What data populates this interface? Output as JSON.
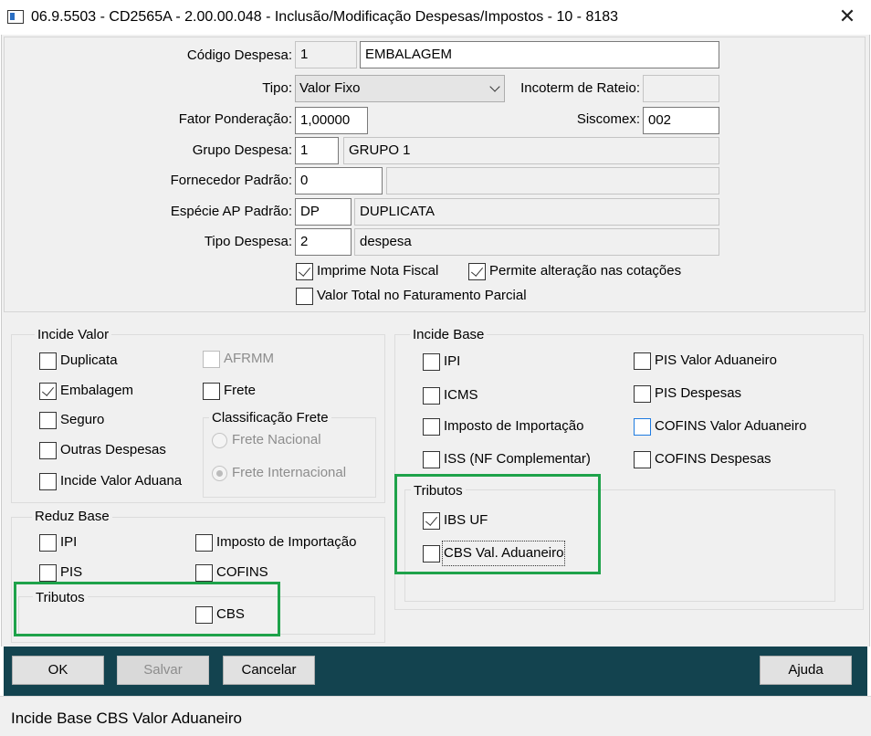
{
  "window": {
    "title": "06.9.5503 - CD2565A - 2.00.00.048 - Inclusão/Modificação Despesas/Impostos - 10 - 8183",
    "close_glyph": "✕"
  },
  "form": {
    "codigo_label": "Código Despesa:",
    "codigo_value": "1",
    "codigo_desc": "EMBALAGEM",
    "tipo_label": "Tipo:",
    "tipo_value": "Valor Fixo",
    "incoterm_label": "Incoterm de Rateio:",
    "incoterm_value": "",
    "fator_label": "Fator Ponderação:",
    "fator_value": "1,00000",
    "siscomex_label": "Siscomex:",
    "siscomex_value": "002",
    "grupo_label": "Grupo Despesa:",
    "grupo_value": "1",
    "grupo_desc": "GRUPO 1",
    "fornecedor_label": "Fornecedor Padrão:",
    "fornecedor_value": "0",
    "fornecedor_desc": "",
    "especie_label": "Espécie AP Padrão:",
    "especie_value": "DP",
    "especie_desc": "DUPLICATA",
    "tipodesp_label": "Tipo Despesa:",
    "tipodesp_value": "2",
    "tipodesp_desc": "despesa",
    "imprime_nf": "Imprime Nota Fiscal",
    "permite_alteracao": "Permite alteração nas cotações",
    "valor_total": "Valor Total no Faturamento Parcial"
  },
  "incide_valor": {
    "title": "Incide Valor",
    "duplicata": "Duplicata",
    "afrmm": "AFRMM",
    "embalagem": "Embalagem",
    "frete": "Frete",
    "seguro": "Seguro",
    "outras": "Outras Despesas",
    "incide_aduana": "Incide Valor Aduana",
    "classificacao": {
      "title": "Classificação Frete",
      "nacional": "Frete Nacional",
      "internacional": "Frete Internacional"
    }
  },
  "reduz_base": {
    "title": "Reduz Base",
    "ipi": "IPI",
    "imposto_importacao": "Imposto de Importação",
    "pis": "PIS",
    "cofins": "COFINS",
    "tributos": {
      "title": "Tributos",
      "cbs": "CBS"
    }
  },
  "incide_base": {
    "title": "Incide Base",
    "ipi": "IPI",
    "pis_valor_aduaneiro": "PIS Valor Aduaneiro",
    "icms": "ICMS",
    "pis_despesas": "PIS Despesas",
    "imposto_importacao": "Imposto de Importação",
    "cofins_valor_aduaneiro": "COFINS Valor Aduaneiro",
    "iss": "ISS (NF Complementar)",
    "cofins_despesas": "COFINS Despesas",
    "tributos": {
      "title": "Tributos",
      "ibs_uf": "IBS UF",
      "cbs_val_aduaneiro": "CBS Val. Aduaneiro"
    }
  },
  "buttons": {
    "ok": "OK",
    "salvar": "Salvar",
    "cancelar": "Cancelar",
    "ajuda": "Ajuda"
  },
  "status_bar": "Incide Base CBS Valor Aduaneiro",
  "colors": {
    "highlight": "#1ea24a",
    "button_bar": "#13434f",
    "focus_blue": "#1e7be0"
  }
}
